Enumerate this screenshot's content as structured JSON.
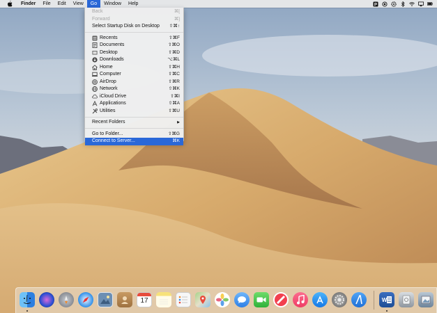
{
  "menubar": {
    "apple_icon": "apple-logo-icon",
    "items": [
      {
        "label": "Finder",
        "app": true
      },
      {
        "label": "File"
      },
      {
        "label": "Edit"
      },
      {
        "label": "View"
      },
      {
        "label": "Go",
        "active": true
      },
      {
        "label": "Window"
      },
      {
        "label": "Help"
      }
    ],
    "status_icons": [
      "parking-icon",
      "eye-icon",
      "gear-icon",
      "bluetooth-icon",
      "wifi-icon",
      "airplay-icon",
      "battery-icon"
    ]
  },
  "go_menu": {
    "items": [
      {
        "label": "Back",
        "shortcut": "⌘[",
        "disabled": true
      },
      {
        "label": "Forward",
        "shortcut": "⌘]",
        "disabled": true
      },
      {
        "label": "Select Startup Disk on Desktop",
        "shortcut": "⇧⌘↑"
      },
      {
        "separator": true
      },
      {
        "label": "Recents",
        "shortcut": "⇧⌘F",
        "icon": "recents-icon"
      },
      {
        "label": "Documents",
        "shortcut": "⇧⌘O",
        "icon": "documents-icon"
      },
      {
        "label": "Desktop",
        "shortcut": "⇧⌘D",
        "icon": "desktop-icon"
      },
      {
        "label": "Downloads",
        "shortcut": "⌥⌘L",
        "icon": "downloads-icon"
      },
      {
        "label": "Home",
        "shortcut": "⇧⌘H",
        "icon": "home-icon"
      },
      {
        "label": "Computer",
        "shortcut": "⇧⌘C",
        "icon": "computer-icon"
      },
      {
        "label": "AirDrop",
        "shortcut": "⇧⌘R",
        "icon": "airdrop-icon"
      },
      {
        "label": "Network",
        "shortcut": "⇧⌘K",
        "icon": "network-icon"
      },
      {
        "label": "iCloud Drive",
        "shortcut": "⇧⌘I",
        "icon": "icloud-icon"
      },
      {
        "label": "Applications",
        "shortcut": "⇧⌘A",
        "icon": "applications-icon"
      },
      {
        "label": "Utilities",
        "shortcut": "⇧⌘U",
        "icon": "utilities-icon"
      },
      {
        "separator": true
      },
      {
        "label": "Recent Folders",
        "submenu": true
      },
      {
        "separator": true
      },
      {
        "label": "Go to Folder...",
        "shortcut": "⇧⌘G"
      },
      {
        "label": "Connect to Server...",
        "shortcut": "⌘K",
        "highlight": true
      }
    ],
    "submenu_arrow": "▶"
  },
  "dock": {
    "calendar_day": "17",
    "icons": [
      {
        "name": "finder-icon",
        "color": "#3b8fe6",
        "running": true
      },
      {
        "name": "siri-icon",
        "color": "#2c2c54"
      },
      {
        "name": "launchpad-icon",
        "color": "#8c9199"
      },
      {
        "name": "safari-icon",
        "color": "#2f8ee8"
      },
      {
        "name": "photo-browser-icon",
        "color": "#6d8fb3"
      },
      {
        "name": "contacts-icon",
        "color": "#b98a54"
      },
      {
        "name": "calendar-icon",
        "color": "#ffffff"
      },
      {
        "name": "notes-icon",
        "color": "#f7e27a"
      },
      {
        "name": "reminders-icon",
        "color": "#f4f4f4"
      },
      {
        "name": "maps-icon",
        "color": "#8fc978"
      },
      {
        "name": "photos-icon",
        "color": "#f2f2f2"
      },
      {
        "name": "messages-icon",
        "color": "#5aa0f4"
      },
      {
        "name": "facetime-icon",
        "color": "#4fc658"
      },
      {
        "name": "news-icon",
        "color": "#f2404f"
      },
      {
        "name": "music-icon",
        "color": "#f05078"
      },
      {
        "name": "app-store-icon",
        "color": "#2a93f2"
      },
      {
        "name": "system-preferences-icon",
        "color": "#7d7d7d"
      },
      {
        "name": "xcode-instruments-icon",
        "color": "#2d7ee6"
      },
      {
        "name": "word-icon",
        "color": "#2b579a",
        "running": true
      },
      {
        "name": "disk-utility-icon",
        "color": "#9aa3ad"
      },
      {
        "name": "preview-icon",
        "color": "#8aa0b6"
      }
    ]
  }
}
